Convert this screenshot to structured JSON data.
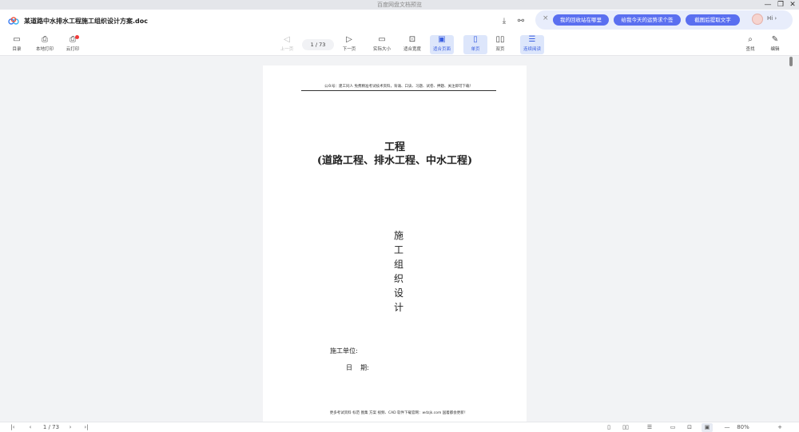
{
  "window": {
    "app_title": "百度网盘文档预览",
    "minimize": "—",
    "restore": "❐",
    "close": "✕"
  },
  "tab": {
    "doc_title": "某道路中水排水工程施工组织设计方案.doc",
    "download_icon": "⤓",
    "share_icon": "⚯"
  },
  "ai_bar": {
    "close": "×",
    "chips": [
      "我的回收站在哪里",
      "给我今天的运势求个签",
      "截图后提取文字"
    ],
    "greeting": "Hi ›"
  },
  "toolbar": {
    "catalog": "目录",
    "local_print": "本地打印",
    "cloud_print": "云打印",
    "prev_page": "上一页",
    "page_indicator": "1 / 73",
    "next_page": "下一页",
    "actual_size": "实际大小",
    "fit_width": "适合宽度",
    "fit_page": "适合页面",
    "single_page": "单页",
    "double_page": "双页",
    "continuous": "连续阅读",
    "find": "查找",
    "edit": "编辑"
  },
  "document": {
    "header": "公众号：建工同人  免费精准考试技术资料，背诵、口诀、习题、试卷、押题、关注即可下载！",
    "title_line1": "工程",
    "title_line2": "(道路工程、排水工程、中水工程)",
    "vertical_title": [
      "施",
      "工",
      "组",
      "织",
      "设",
      "计"
    ],
    "unit_label": "施工单位:",
    "date_label": "日    期:",
    "footer": "更多考试资料 标范 图集 方案 视频、CAD 软件下载官网：wdzjk.com 国着都会更新！"
  },
  "statusbar": {
    "first": "|‹",
    "prev": "‹",
    "page_indicator": "1 / 73",
    "next": "›",
    "last": "›|",
    "zoom_out": "—",
    "zoom_value": "80%",
    "zoom_in": "+"
  },
  "colors": {
    "accent": "#3a5fe0",
    "chip": "#5a6ff0",
    "page_bg": "#f2f3f5"
  }
}
